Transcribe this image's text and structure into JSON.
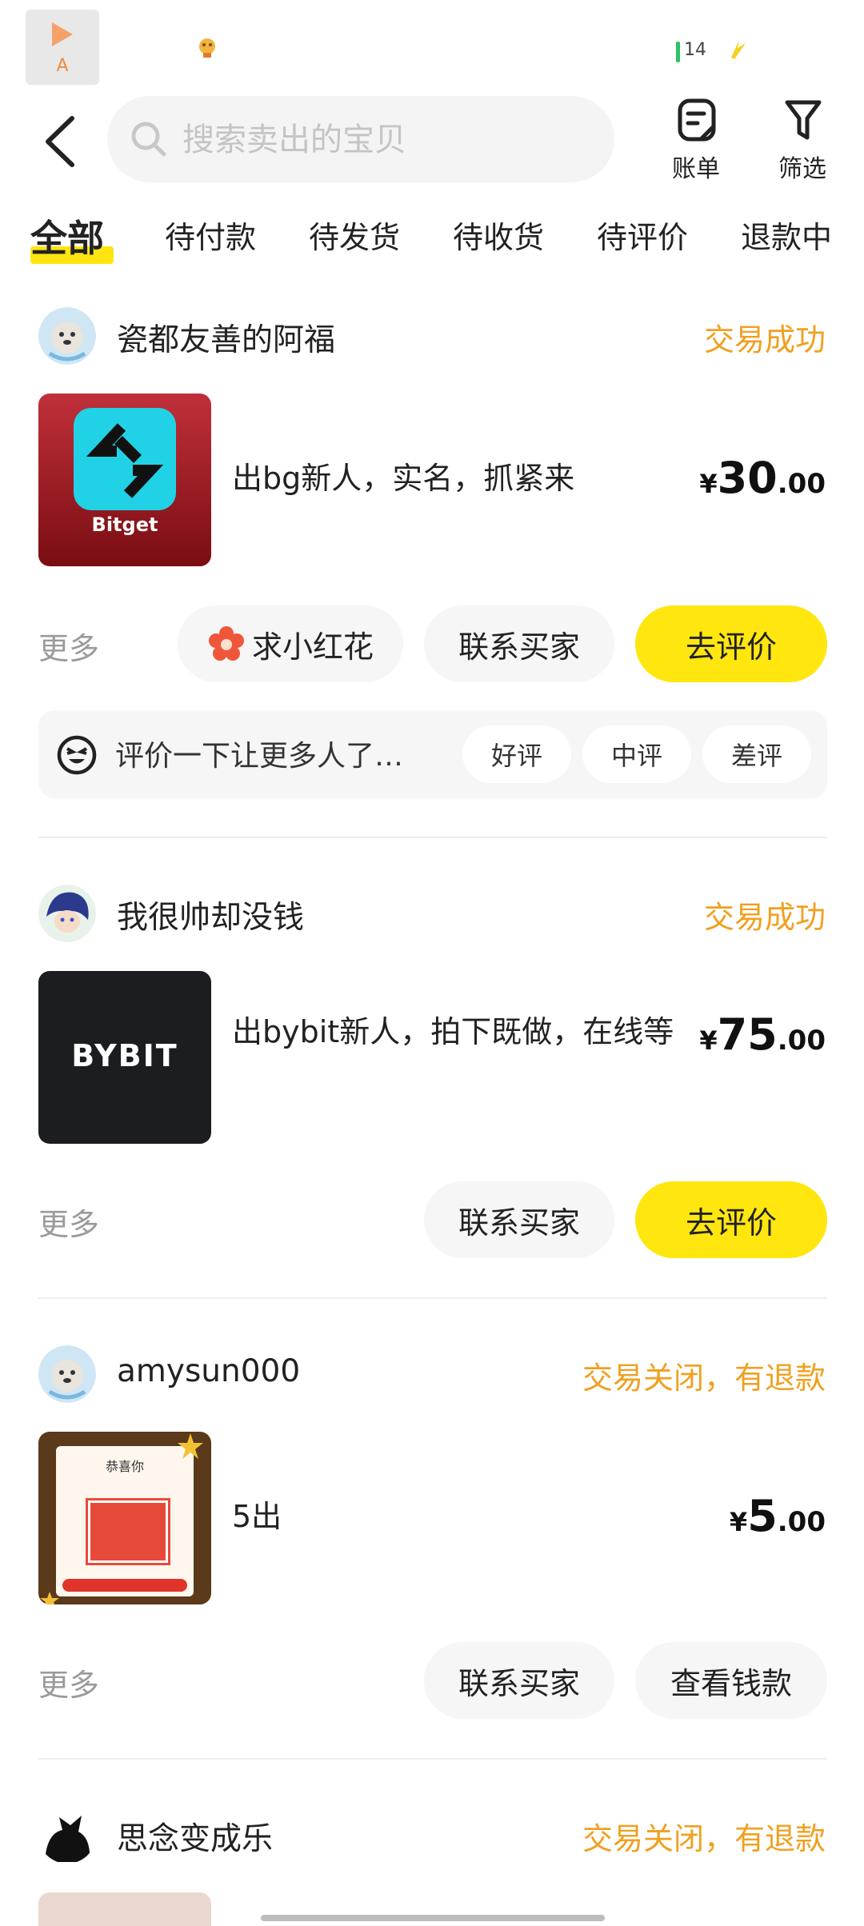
{
  "status_bar": {
    "app_label": "A",
    "battery": "14"
  },
  "search": {
    "placeholder": "搜索卖出的宝贝"
  },
  "header": {
    "bill_label": "账单",
    "filter_label": "筛选"
  },
  "tabs": [
    "全部",
    "待付款",
    "待发货",
    "待收货",
    "待评价",
    "退款中"
  ],
  "orders": [
    {
      "seller": "瓷都友善的阿福",
      "status": "交易成功",
      "thumb_text": "Bitget",
      "title": "出bg新人，实名，抓紧来",
      "price": {
        "currency": "¥",
        "integer": "30",
        "decimal": ".00"
      },
      "more": "更多",
      "buttons": [
        "求小红花",
        "联系买家",
        "去评价"
      ],
      "review_prompt": "评价一下让更多人了…",
      "review_options": [
        "好评",
        "中评",
        "差评"
      ]
    },
    {
      "seller": "我很帅却没钱",
      "status": "交易成功",
      "thumb_text": "BYBIT",
      "title": "出bybit新人，拍下既做，在线等",
      "price": {
        "currency": "¥",
        "integer": "75",
        "decimal": ".00"
      },
      "more": "更多",
      "buttons": [
        "联系买家",
        "去评价"
      ]
    },
    {
      "seller": "amysun000",
      "status": "交易关闭，有退款",
      "thumb_text": "恭喜你",
      "title": "5出",
      "price": {
        "currency": "¥",
        "integer": "5",
        "decimal": ".00"
      },
      "more": "更多",
      "buttons": [
        "联系买家",
        "查看钱款"
      ]
    },
    {
      "seller": "思念变成乐",
      "status": "交易关闭，有退款"
    }
  ],
  "colors": {
    "accent_yellow": "#ffe60f",
    "status_orange": "#f0a020"
  }
}
